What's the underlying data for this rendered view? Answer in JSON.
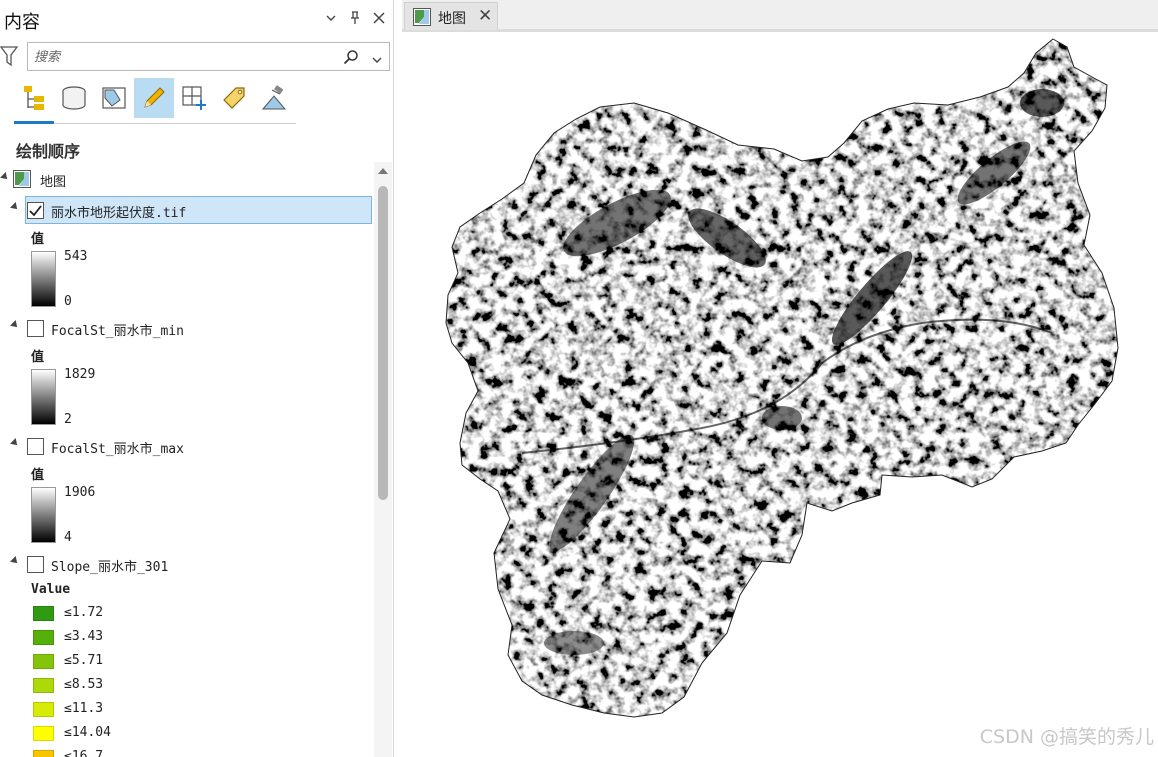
{
  "pane": {
    "title": "内容",
    "search_placeholder": "搜索",
    "section_title": "绘制顺序",
    "toolbar_icons": [
      "list-by-drawing-order-icon",
      "list-by-source-icon",
      "list-by-selection-icon",
      "list-by-editing-icon",
      "list-by-snapping-icon",
      "list-by-labeling-icon",
      "list-by-perspective-imagery-icon"
    ],
    "map_node": "地图",
    "layers": [
      {
        "name": "丽水市地形起伏度.tif",
        "checked": true,
        "selected": true,
        "legend_title": "值",
        "high": "543",
        "low": "0"
      },
      {
        "name": "FocalSt_丽水市_min",
        "checked": false,
        "legend_title": "值",
        "high": "1829",
        "low": "2"
      },
      {
        "name": "FocalSt_丽水市_max",
        "checked": false,
        "legend_title": "值",
        "high": "1906",
        "low": "4"
      },
      {
        "name": "Slope_丽水市_301",
        "checked": false,
        "legend_title": "Value",
        "classes": [
          {
            "label": "≤1.72",
            "color": "#2f9a12"
          },
          {
            "label": "≤3.43",
            "color": "#56b00a"
          },
          {
            "label": "≤5.71",
            "color": "#84c50c"
          },
          {
            "label": "≤8.53",
            "color": "#abd90a"
          },
          {
            "label": "≤11.3",
            "color": "#d6ec08"
          },
          {
            "label": "≤14.04",
            "color": "#ffff00"
          },
          {
            "label": "≤16.7",
            "color": "#f7c600"
          }
        ]
      }
    ]
  },
  "map_tab": {
    "label": "地图"
  },
  "watermark": "CSDN @搞笑的秀儿"
}
